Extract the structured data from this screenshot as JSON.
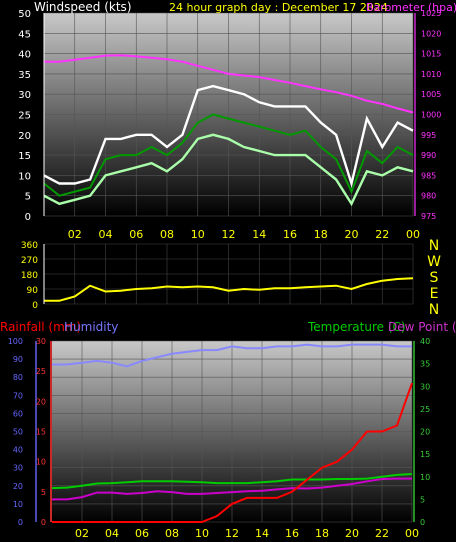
{
  "colors": {
    "background": "#000000",
    "axis_text": "#ffff00",
    "grid": "#555555",
    "wind_gust": "#ffffff",
    "wind_speed": "#aaffaa",
    "wind_avg": "#009900",
    "pressure": "#ff33ff",
    "direction": "#ffff00",
    "rain": "#ff0000",
    "humidity": "#8888ff",
    "temperature": "#00cc00",
    "dewpoint": "#cc00cc",
    "rain_axis": "#ff3333",
    "hum_axis": "#6666ff",
    "temp_axis": "#33cc33"
  },
  "chart_data": [
    {
      "type": "line",
      "title": "24 hour graph day : December 17 2024",
      "ylabel": "Windspeed (kts)",
      "y2label": "Barometer (hpa)",
      "xticks": [
        "02",
        "04",
        "06",
        "08",
        "10",
        "12",
        "14",
        "16",
        "18",
        "20",
        "22",
        "00"
      ],
      "ylim": [
        0,
        50
      ],
      "yticks": [
        "0",
        "5",
        "10",
        "15",
        "20",
        "25",
        "30",
        "35",
        "40",
        "45",
        "50"
      ],
      "y2lim": [
        975,
        1025
      ],
      "y2ticks": [
        "975",
        "980",
        "985",
        "990",
        "995",
        "1000",
        "1005",
        "1010",
        "1015",
        "1020",
        "1025"
      ],
      "x": [
        0,
        1,
        2,
        3,
        4,
        5,
        6,
        7,
        8,
        9,
        10,
        11,
        12,
        13,
        14,
        15,
        16,
        17,
        18,
        19,
        20,
        21,
        22,
        23,
        24
      ],
      "series": [
        {
          "name": "gust",
          "values": [
            10,
            8,
            8,
            9,
            19,
            19,
            20,
            20,
            17,
            20,
            31,
            32,
            31,
            30,
            28,
            27,
            27,
            27,
            23,
            20,
            8,
            24,
            17,
            23,
            21
          ]
        },
        {
          "name": "avg",
          "values": [
            8,
            5,
            6,
            7,
            14,
            15,
            15,
            17,
            15,
            18,
            23,
            25,
            24,
            23,
            22,
            21,
            20,
            21,
            17,
            14,
            6,
            16,
            13,
            17,
            15
          ]
        },
        {
          "name": "speed",
          "values": [
            5,
            3,
            4,
            5,
            10,
            11,
            12,
            13,
            11,
            14,
            19,
            20,
            19,
            17,
            16,
            15,
            15,
            15,
            12,
            9,
            3,
            11,
            10,
            12,
            11
          ]
        },
        {
          "name": "pressure",
          "values": [
            1013,
            1013,
            1013.5,
            1014,
            1014.5,
            1014.6,
            1014.3,
            1014,
            1013.6,
            1013,
            1012,
            1011,
            1010,
            1009.6,
            1009.2,
            1008.5,
            1007.8,
            1007,
            1006.2,
            1005.5,
            1004.6,
            1003.4,
            1002.6,
            1001.5,
            1000.5
          ]
        }
      ]
    },
    {
      "type": "line",
      "ylim": [
        0,
        360
      ],
      "yticks": [
        "0",
        "90",
        "180",
        "270",
        "360"
      ],
      "compass": [
        "N",
        "W",
        "S",
        "E",
        "N"
      ],
      "x": [
        0,
        1,
        2,
        3,
        4,
        5,
        6,
        7,
        8,
        9,
        10,
        11,
        12,
        13,
        14,
        15,
        16,
        17,
        18,
        19,
        20,
        21,
        22,
        23,
        24
      ],
      "series": [
        {
          "name": "direction",
          "values": [
            20,
            20,
            45,
            110,
            75,
            80,
            90,
            95,
            105,
            100,
            105,
            100,
            80,
            90,
            85,
            95,
            95,
            100,
            105,
            110,
            90,
            120,
            140,
            150,
            155
          ]
        }
      ]
    },
    {
      "type": "line",
      "legend": [
        "Rainfall (mm)",
        "Humidity",
        "Temperature (C)",
        "Dew Point (C)"
      ],
      "xticks": [
        "02",
        "04",
        "06",
        "08",
        "10",
        "12",
        "14",
        "16",
        "18",
        "20",
        "22",
        "00"
      ],
      "ylim_hum": [
        0,
        100
      ],
      "yticks_hum": [
        "0",
        "10",
        "20",
        "30",
        "40",
        "50",
        "60",
        "70",
        "80",
        "90",
        "100"
      ],
      "ylim_rain": [
        0,
        30
      ],
      "yticks_rain": [
        "0",
        "5",
        "10",
        "15",
        "20",
        "25",
        "30"
      ],
      "ylim_temp": [
        0,
        40
      ],
      "yticks_temp": [
        "0",
        "5",
        "10",
        "15",
        "20",
        "25",
        "30",
        "35",
        "40"
      ],
      "x": [
        0,
        1,
        2,
        3,
        4,
        5,
        6,
        7,
        8,
        9,
        10,
        11,
        12,
        13,
        14,
        15,
        16,
        17,
        18,
        19,
        20,
        21,
        22,
        23,
        24
      ],
      "series": [
        {
          "name": "humidity",
          "values": [
            87,
            87,
            88,
            89,
            88,
            86,
            89,
            91,
            93,
            94,
            95,
            95,
            97,
            96,
            96,
            97,
            97,
            98,
            97,
            97,
            98,
            98,
            98,
            97,
            97
          ]
        },
        {
          "name": "temperature",
          "values": [
            7.5,
            7.6,
            8,
            8.5,
            8.6,
            8.8,
            9,
            9,
            9,
            8.9,
            8.8,
            8.6,
            8.6,
            8.6,
            8.8,
            9,
            9.4,
            9.4,
            9.4,
            9.5,
            9.5,
            9.6,
            10,
            10.4,
            10.6
          ]
        },
        {
          "name": "dewpoint",
          "values": [
            5,
            5,
            5.5,
            6.5,
            6.5,
            6.2,
            6.4,
            6.8,
            6.6,
            6.2,
            6.2,
            6.4,
            6.6,
            6.8,
            6.9,
            7.2,
            7.5,
            7.4,
            7.6,
            8,
            8.4,
            9,
            9.5,
            9.6,
            9.6
          ]
        },
        {
          "name": "rain",
          "values": [
            0,
            0,
            0,
            0,
            0,
            0,
            0,
            0,
            0,
            0,
            0,
            1,
            3,
            4,
            4,
            4,
            5,
            7,
            9,
            10,
            12,
            15,
            15,
            16,
            23
          ]
        }
      ]
    }
  ]
}
